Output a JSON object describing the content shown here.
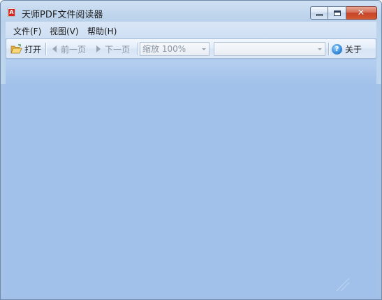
{
  "window": {
    "title": "天师PDF文件阅读器",
    "app_icon_letter": "A"
  },
  "caption_buttons": {
    "minimize_icon": "minimize-icon",
    "maximize_icon": "maximize-icon",
    "close_icon": "close-icon",
    "close_glyph": "✕"
  },
  "menu": {
    "items": [
      {
        "label": "文件(F)"
      },
      {
        "label": "视图(V)"
      },
      {
        "label": "帮助(H)"
      }
    ]
  },
  "toolbar": {
    "open_label": "打开",
    "prev_label": "前一页",
    "next_label": "下一页",
    "zoom_value": "缩放 100%",
    "page_value": "",
    "about_label": "关于",
    "help_glyph": "?"
  },
  "colors": {
    "client_background": "#a3c1e8",
    "title_bar": "#c9dcf1",
    "close_button": "#c9452c",
    "disabled_text": "#8b95a3"
  }
}
